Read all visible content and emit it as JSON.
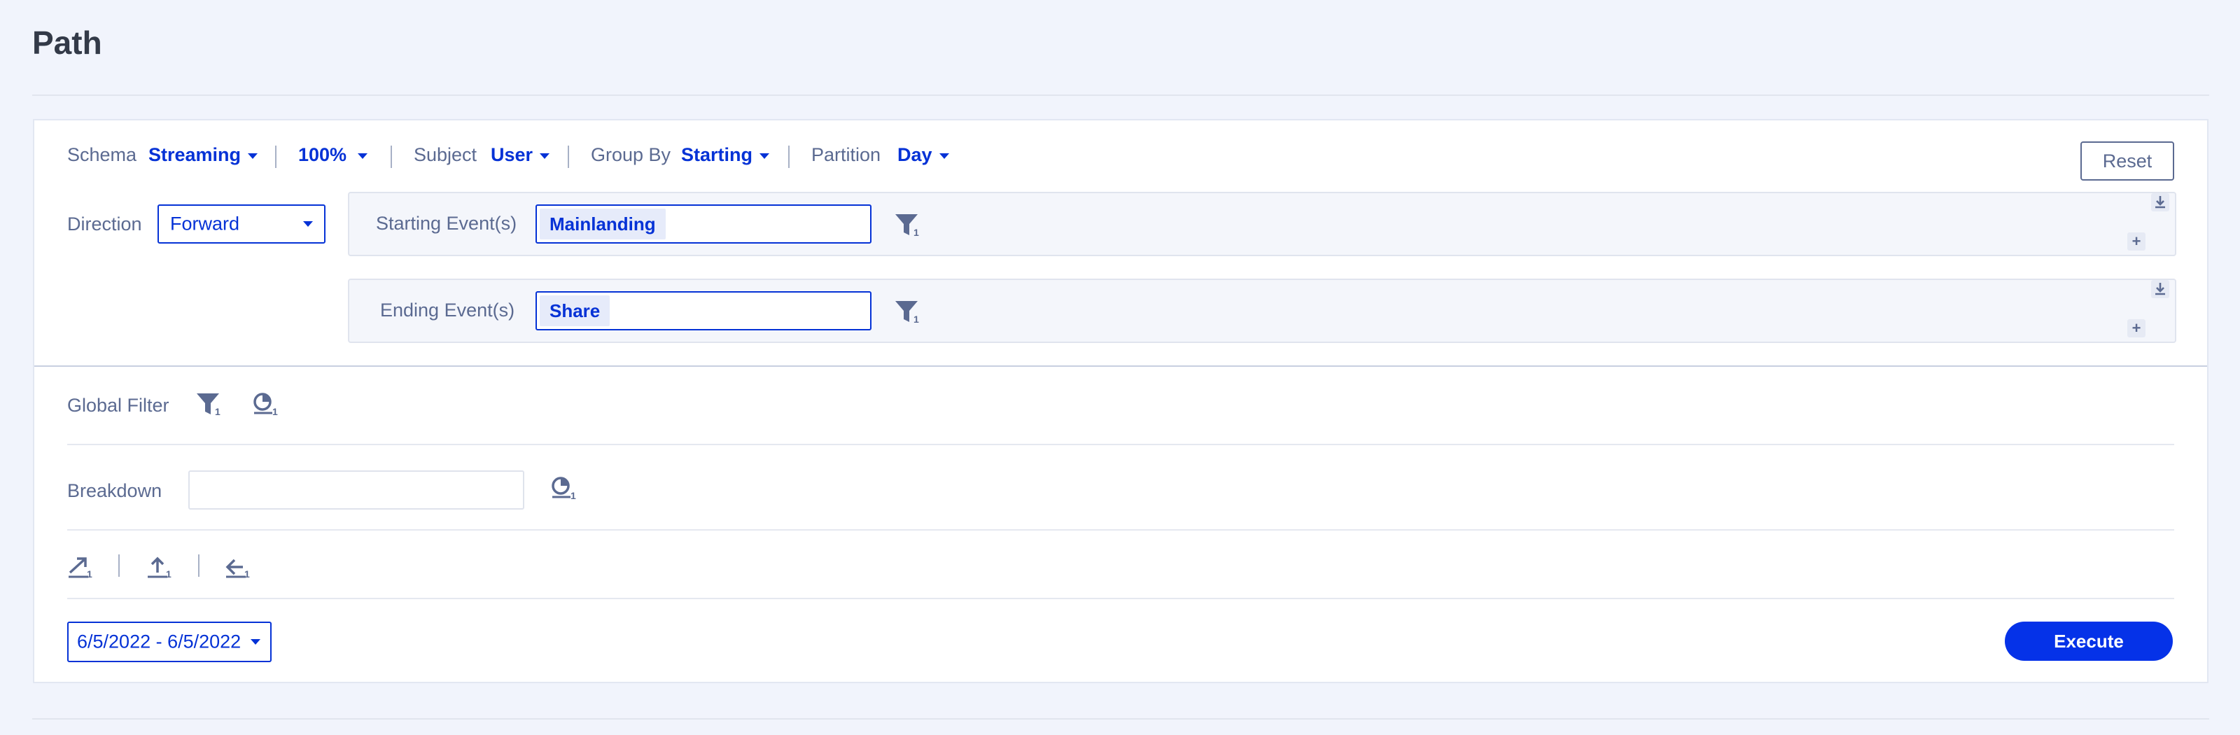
{
  "page": {
    "title": "Path"
  },
  "toolbar": {
    "schema_label": "Schema",
    "schema_value": "Streaming",
    "sample_value": "100%",
    "subject_label": "Subject",
    "subject_value": "User",
    "group_by_label": "Group By",
    "group_by_value": "Starting",
    "partition_label": "Partition",
    "partition_value": "Day",
    "reset_label": "Reset"
  },
  "direction": {
    "label": "Direction",
    "value": "Forward"
  },
  "starting_events": {
    "label": "Starting Event(s)",
    "chip": "Mainlanding",
    "filter_count": "1"
  },
  "ending_events": {
    "label": "Ending Event(s)",
    "chip": "Share",
    "filter_count": "1"
  },
  "global_filter": {
    "label": "Global Filter",
    "filter_count": "1",
    "segment_count": "1"
  },
  "breakdown": {
    "label": "Breakdown",
    "value": "",
    "segment_count": "1"
  },
  "path_actions": {
    "counts": [
      "1",
      "1",
      "1"
    ]
  },
  "date_range": {
    "value": "6/5/2022 - 6/5/2022"
  },
  "execute": {
    "label": "Execute"
  },
  "colors": {
    "accent": "#0532d6",
    "button": "#0532e8",
    "muted": "#5b6a91",
    "background": "#f1f4fc"
  }
}
